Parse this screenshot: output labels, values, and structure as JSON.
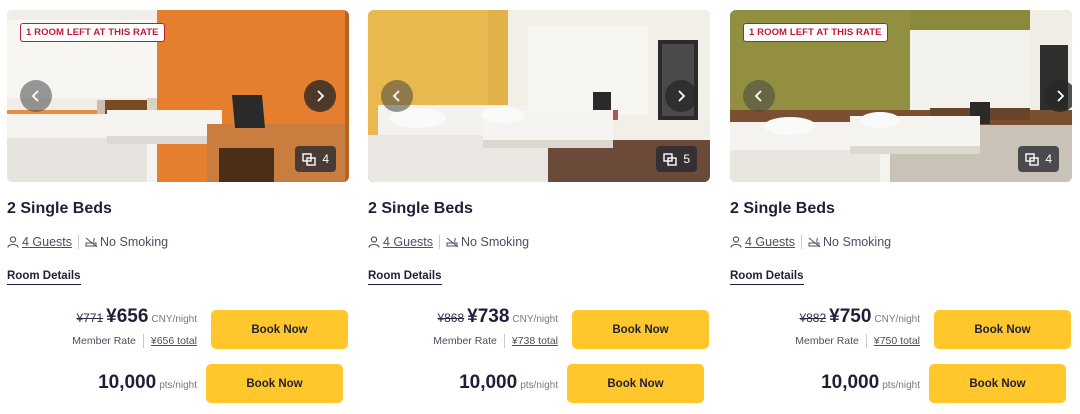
{
  "rooms": [
    {
      "badge": "1 ROOM LEFT AT THIS RATE",
      "photo_count": "4",
      "title": "2 Single Beds",
      "guests": "4 Guests",
      "smoking": "No Smoking",
      "details_label": "Room Details",
      "old_price": "¥771",
      "price": "¥656",
      "price_unit": "CNY/night",
      "member_rate_label": "Member Rate",
      "total": "¥656 total",
      "book_label": "Book Now",
      "points": "10,000",
      "points_unit": "pts/night",
      "points_book_label": "Book Now"
    },
    {
      "badge": "",
      "photo_count": "5",
      "title": "2 Single Beds",
      "guests": "4 Guests",
      "smoking": "No Smoking",
      "details_label": "Room Details",
      "old_price": "¥868",
      "price": "¥738",
      "price_unit": "CNY/night",
      "member_rate_label": "Member Rate",
      "total": "¥738 total",
      "book_label": "Book Now",
      "points": "10,000",
      "points_unit": "pts/night",
      "points_book_label": "Book Now"
    },
    {
      "badge": "1 ROOM LEFT AT THIS RATE",
      "photo_count": "4",
      "title": "2 Single Beds",
      "guests": "4 Guests",
      "smoking": "No Smoking",
      "details_label": "Room Details",
      "old_price": "¥882",
      "price": "¥750",
      "price_unit": "CNY/night",
      "member_rate_label": "Member Rate",
      "total": "¥750 total",
      "book_label": "Book Now",
      "points": "10,000",
      "points_unit": "pts/night",
      "points_book_label": "Book Now"
    }
  ],
  "icons": {
    "prev": "chevron-left-icon",
    "next": "chevron-right-icon",
    "gallery": "gallery-icon",
    "guests": "person-icon",
    "smoking": "no-smoking-icon"
  },
  "colors": {
    "accent_button": "#ffc72c",
    "badge": "#c4183b",
    "text_dark": "#1f1f3a"
  }
}
